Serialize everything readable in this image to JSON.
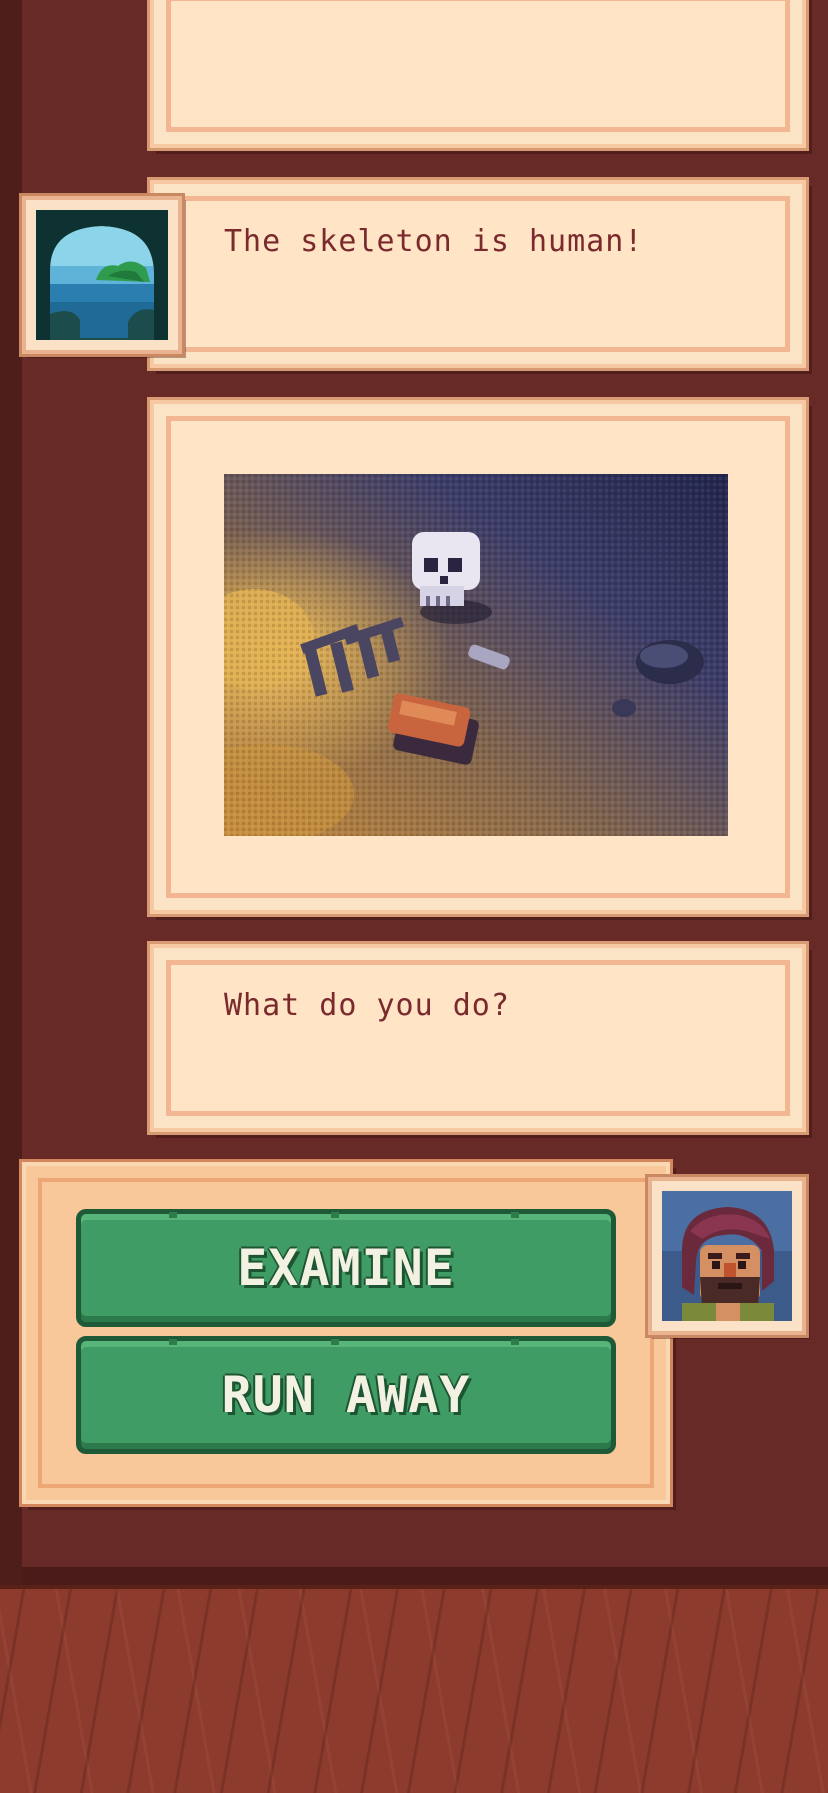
{
  "messages": {
    "narrator_line": "The skeleton is human!",
    "prompt": "What do you do?"
  },
  "choices": {
    "examine": "EXAMINE",
    "run_away": "RUN AWAY"
  },
  "icons": {
    "narrator_avatar": "island-cave-view-portrait",
    "player_avatar": "bearded-man-portrait",
    "scene": "skeleton-on-sand-pixel-art"
  },
  "colors": {
    "board": "#672a26",
    "parchment": "#ffe4c6",
    "text": "#7a2a2c",
    "button": "#3f9c64"
  }
}
